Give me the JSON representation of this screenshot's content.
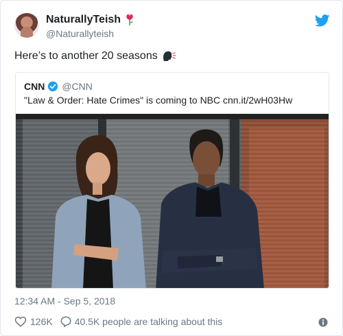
{
  "author": {
    "display_name": "NaturallyTeish",
    "handle": "@Naturallyteish"
  },
  "tweet": {
    "text": "Here’s to another 20 seasons",
    "timestamp": "12:34 AM - Sep 5, 2018"
  },
  "quoted_tweet": {
    "display_name": "CNN",
    "handle": "@CNN",
    "text": "\"Law & Order: Hate Crimes\" is coming to NBC cnn.it/2wH03Hw"
  },
  "engagement": {
    "likes": "126K",
    "conversation": "40.5K people are talking about this"
  },
  "colors": {
    "brand_blue": "#1da1f2",
    "secondary_text": "#697882",
    "border": "#e1e8ed"
  },
  "icons": {
    "author_emoji": "flower-icon",
    "tweet_emoji": "speaking-head-icon",
    "logo": "twitter-bird-icon",
    "verified": "verified-badge-icon",
    "like": "heart-icon",
    "reply": "comment-icon",
    "info": "info-icon"
  }
}
